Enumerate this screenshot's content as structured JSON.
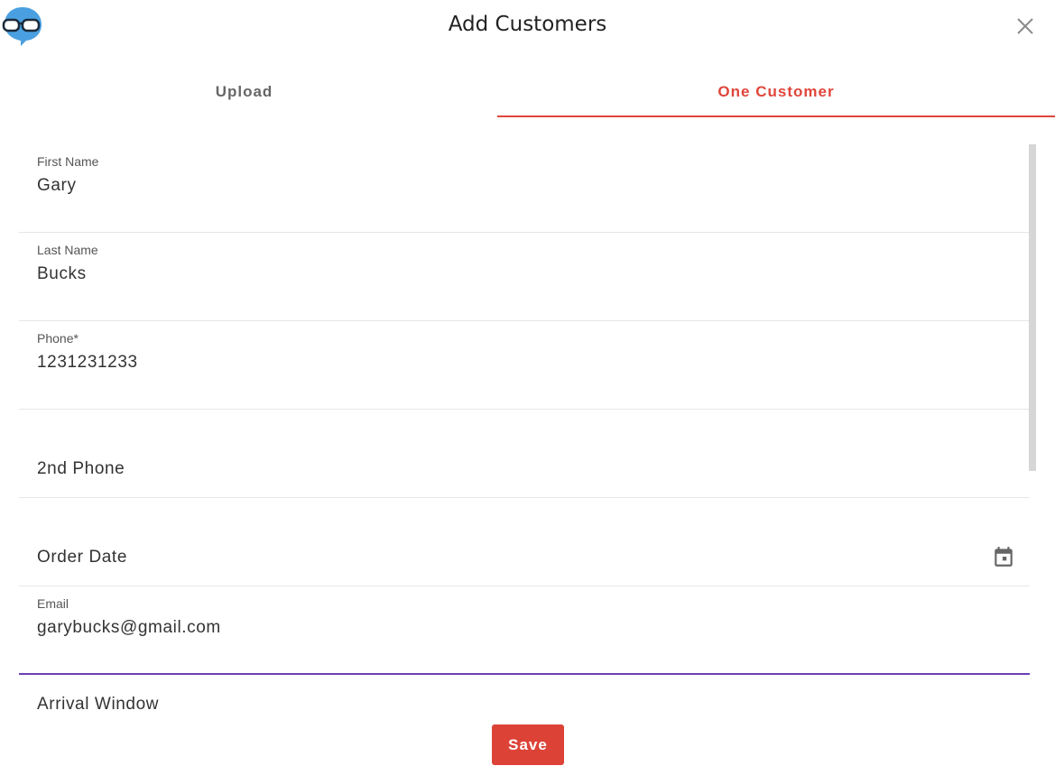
{
  "dialog": {
    "title": "Add Customers"
  },
  "tabs": [
    {
      "label": "Upload",
      "active": false
    },
    {
      "label": "One Customer",
      "active": true
    }
  ],
  "form": {
    "first_name": {
      "label": "First Name",
      "value": "Gary"
    },
    "last_name": {
      "label": "Last Name",
      "value": "Bucks"
    },
    "phone": {
      "label": "Phone*",
      "value": "1231231233"
    },
    "second_phone": {
      "placeholder": "2nd Phone"
    },
    "order_date": {
      "placeholder": "Order Date"
    },
    "email": {
      "label": "Email",
      "value": "garybucks@gmail.com"
    },
    "arrival_window": {
      "placeholder": "Arrival Window"
    }
  },
  "actions": {
    "save_label": "Save"
  },
  "colors": {
    "accent": "#e0463b",
    "focus": "#6a3fb5",
    "logo": "#4a9fe0"
  },
  "icons": {
    "logo": "glasses-bubble-icon",
    "close": "close-icon",
    "calendar": "calendar-icon"
  }
}
